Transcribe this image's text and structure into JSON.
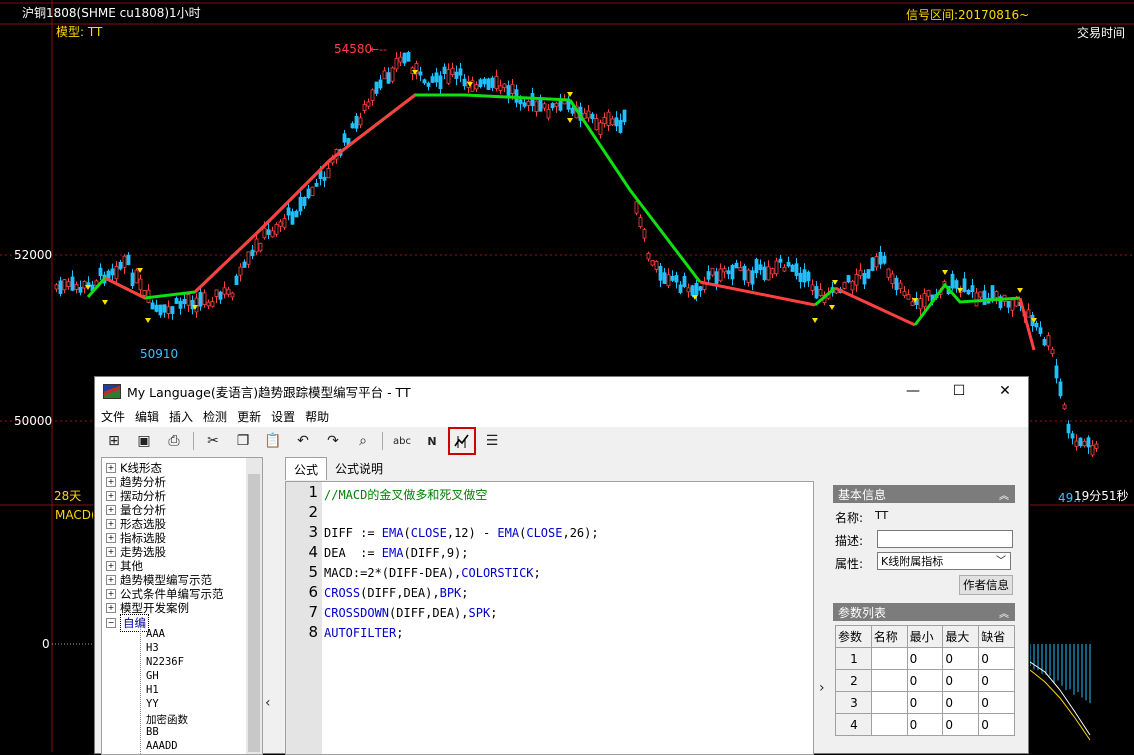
{
  "chart": {
    "title": "沪铜1808(SHME cu1808)1小时",
    "signal_range": "信号区间:20170816~",
    "model_label": "模型: TT",
    "trade_time_label": "交易时间",
    "price_high": "54580",
    "price_low": "50910",
    "y_tick_52000": "52000",
    "y_tick_50000": "50000",
    "y_tick_0": "0",
    "days": "28天",
    "macd_label": "MACD(",
    "right_price": "49...",
    "timer": "19分51秒",
    "colors": {
      "background": "#000000",
      "up": "#ff4040",
      "down": "#20c0ff",
      "buy_line": "#ff4040",
      "sell_line": "#10e010",
      "signal": "#ffe000"
    }
  },
  "window": {
    "title": "My Language(麦语言)趋势跟踪模型编写平台 - TT",
    "controls": {
      "minimize": "—",
      "maximize": "☐",
      "close": "✕"
    },
    "menu": [
      "文件",
      "编辑",
      "插入",
      "检测",
      "更新",
      "设置",
      "帮助"
    ],
    "toolbar_icons": [
      "new-icon",
      "save-icon",
      "print-icon",
      "cut-icon",
      "copy-icon",
      "paste-icon",
      "undo-icon",
      "redo-icon",
      "find-icon",
      "spellcheck-icon",
      "function-icon",
      "model-test-icon",
      "notes-icon"
    ]
  },
  "tree": {
    "groups": [
      "K线形态",
      "趋势分析",
      "摆动分析",
      "量仓分析",
      "形态选股",
      "指标选股",
      "走势选股",
      "其他",
      "趋势模型编写示范",
      "公式条件单编写示范",
      "模型开发案例"
    ],
    "custom_group": "自编",
    "items": [
      "AAA",
      "H3",
      "N2236F",
      "GH",
      "H1",
      "YY",
      "加密函数",
      "BB",
      "AAADD"
    ]
  },
  "tabs": [
    "公式",
    "公式说明"
  ],
  "code": {
    "lines": [
      {
        "n": "1",
        "segments": [
          {
            "t": "//MACD的金叉做多和死叉做空",
            "c": "cm"
          }
        ]
      },
      {
        "n": "2",
        "segments": []
      },
      {
        "n": "3",
        "segments": [
          {
            "t": "DIFF := "
          },
          {
            "t": "EMA",
            "c": "kw"
          },
          {
            "t": "("
          },
          {
            "t": "CLOSE",
            "c": "kw"
          },
          {
            "t": ",12) - "
          },
          {
            "t": "EMA",
            "c": "kw"
          },
          {
            "t": "("
          },
          {
            "t": "CLOSE",
            "c": "kw"
          },
          {
            "t": ",26);"
          }
        ]
      },
      {
        "n": "4",
        "segments": [
          {
            "t": "DEA  := "
          },
          {
            "t": "EMA",
            "c": "kw"
          },
          {
            "t": "(DIFF,9);"
          }
        ]
      },
      {
        "n": "5",
        "segments": [
          {
            "t": "MACD:=2*(DIFF-DEA),"
          },
          {
            "t": "COLORSTICK",
            "c": "kw"
          },
          {
            "t": ";"
          }
        ]
      },
      {
        "n": "6",
        "segments": [
          {
            "t": "CROSS",
            "c": "kw"
          },
          {
            "t": "(DIFF,DEA),"
          },
          {
            "t": "BPK",
            "c": "kw"
          },
          {
            "t": ";"
          }
        ]
      },
      {
        "n": "7",
        "segments": [
          {
            "t": "CROSSDOWN",
            "c": "kw"
          },
          {
            "t": "(DIFF,DEA),"
          },
          {
            "t": "SPK",
            "c": "kw"
          },
          {
            "t": ";"
          }
        ]
      },
      {
        "n": "8",
        "segments": [
          {
            "t": "AUTOFILTER",
            "c": "kw"
          },
          {
            "t": ";"
          }
        ]
      }
    ]
  },
  "basic_info": {
    "header": "基本信息",
    "name_label": "名称:",
    "name_value": "TT",
    "desc_label": "描述:",
    "desc_value": "",
    "attr_label": "属性:",
    "attr_value": "K线附属指标",
    "author_button": "作者信息"
  },
  "params": {
    "header": "参数列表",
    "columns": [
      "参数",
      "名称",
      "最小",
      "最大",
      "缺省"
    ],
    "rows": [
      [
        "1",
        "",
        "0",
        "0",
        "0"
      ],
      [
        "2",
        "",
        "0",
        "0",
        "0"
      ],
      [
        "3",
        "",
        "0",
        "0",
        "0"
      ],
      [
        "4",
        "",
        "0",
        "0",
        "0"
      ]
    ]
  }
}
